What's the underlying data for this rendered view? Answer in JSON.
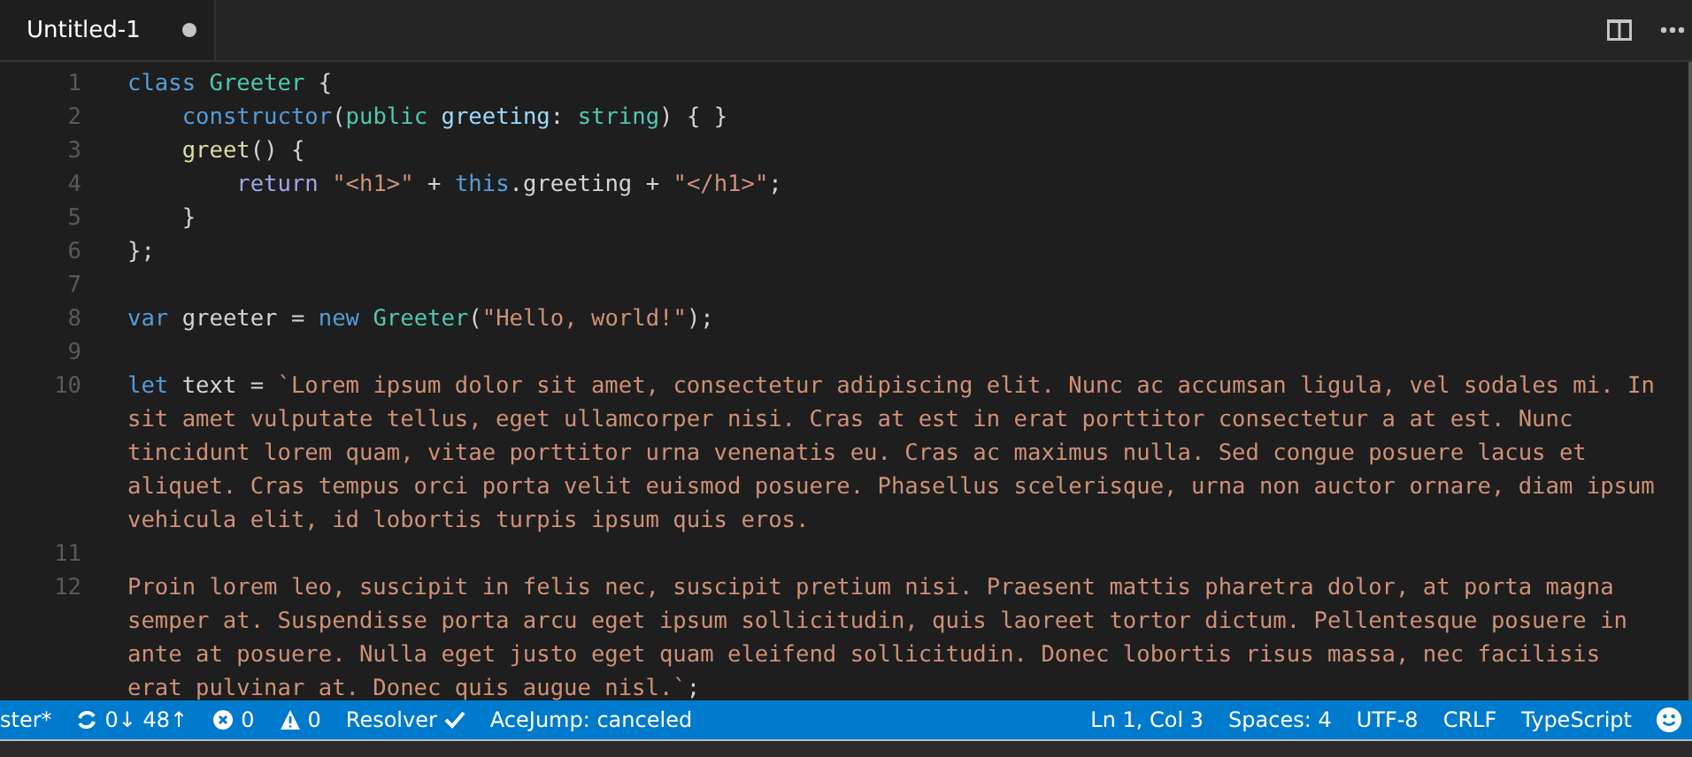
{
  "tab": {
    "title": "Untitled-1",
    "dirty": true
  },
  "lines": [
    {
      "number": "1",
      "rows": [
        [
          {
            "kind": "kw",
            "text": "class"
          },
          {
            "kind": "plain",
            "text": " "
          },
          {
            "kind": "type",
            "text": "Greeter"
          },
          {
            "kind": "plain",
            "text": " {"
          }
        ]
      ]
    },
    {
      "number": "2",
      "rows": [
        [
          {
            "kind": "plain",
            "text": "    "
          },
          {
            "kind": "kw",
            "text": "constructor"
          },
          {
            "kind": "plain",
            "text": "("
          },
          {
            "kind": "type",
            "text": "public"
          },
          {
            "kind": "plain",
            "text": " "
          },
          {
            "kind": "var",
            "text": "greeting"
          },
          {
            "kind": "plain",
            "text": ": "
          },
          {
            "kind": "type",
            "text": "string"
          },
          {
            "kind": "plain",
            "text": ") { }"
          }
        ]
      ]
    },
    {
      "number": "3",
      "rows": [
        [
          {
            "kind": "plain",
            "text": "    "
          },
          {
            "kind": "fn",
            "text": "greet"
          },
          {
            "kind": "plain",
            "text": "() {"
          }
        ]
      ]
    },
    {
      "number": "4",
      "rows": [
        [
          {
            "kind": "plain",
            "text": "        "
          },
          {
            "kind": "ctrl",
            "text": "return"
          },
          {
            "kind": "plain",
            "text": " "
          },
          {
            "kind": "str",
            "text": "\"<h1>\""
          },
          {
            "kind": "plain",
            "text": " + "
          },
          {
            "kind": "kw",
            "text": "this"
          },
          {
            "kind": "plain",
            "text": ".greeting + "
          },
          {
            "kind": "str",
            "text": "\"</h1>\""
          },
          {
            "kind": "plain",
            "text": ";"
          }
        ]
      ]
    },
    {
      "number": "5",
      "rows": [
        [
          {
            "kind": "plain",
            "text": "    }"
          }
        ]
      ]
    },
    {
      "number": "6",
      "rows": [
        [
          {
            "kind": "plain",
            "text": "};"
          }
        ]
      ]
    },
    {
      "number": "7",
      "rows": [
        []
      ]
    },
    {
      "number": "8",
      "rows": [
        [
          {
            "kind": "kw",
            "text": "var"
          },
          {
            "kind": "plain",
            "text": " greeter = "
          },
          {
            "kind": "kw",
            "text": "new"
          },
          {
            "kind": "plain",
            "text": " "
          },
          {
            "kind": "type",
            "text": "Greeter"
          },
          {
            "kind": "plain",
            "text": "("
          },
          {
            "kind": "str",
            "text": "\"Hello, world!\""
          },
          {
            "kind": "plain",
            "text": ");"
          }
        ]
      ]
    },
    {
      "number": "9",
      "rows": [
        []
      ]
    },
    {
      "number": "10",
      "rows": [
        [
          {
            "kind": "kw",
            "text": "let"
          },
          {
            "kind": "plain",
            "text": " text = "
          },
          {
            "kind": "str",
            "text": "`Lorem ipsum dolor sit amet, consectetur adipiscing elit. Nunc ac accumsan ligula, vel sodales mi. In"
          }
        ],
        [
          {
            "kind": "str",
            "text": "sit amet vulputate tellus, eget ullamcorper nisi. Cras at est in erat porttitor consectetur a at est. Nunc"
          }
        ],
        [
          {
            "kind": "str",
            "text": "tincidunt lorem quam, vitae porttitor urna venenatis eu. Cras ac maximus nulla. Sed congue posuere lacus et"
          }
        ],
        [
          {
            "kind": "str",
            "text": "aliquet. Cras tempus orci porta velit euismod posuere. Phasellus scelerisque, urna non auctor ornare, diam ipsum"
          }
        ],
        [
          {
            "kind": "str",
            "text": "vehicula elit, id lobortis turpis ipsum quis eros."
          }
        ]
      ]
    },
    {
      "number": "11",
      "rows": [
        []
      ]
    },
    {
      "number": "12",
      "rows": [
        [
          {
            "kind": "str",
            "text": "Proin lorem leo, suscipit in felis nec, suscipit pretium nisi. Praesent mattis pharetra dolor, at porta magna"
          }
        ],
        [
          {
            "kind": "str",
            "text": "semper at. Suspendisse porta arcu eget ipsum sollicitudin, quis laoreet tortor dictum. Pellentesque posuere in"
          }
        ],
        [
          {
            "kind": "str",
            "text": "ante at posuere. Nulla eget justo eget quam eleifend sollicitudin. Donec lobortis risus massa, nec facilisis"
          }
        ],
        [
          {
            "kind": "str",
            "text": "erat pulvinar at. Donec quis augue nisl.`"
          },
          {
            "kind": "plain",
            "text": ";"
          }
        ]
      ]
    }
  ],
  "status_bar": {
    "left": [
      {
        "kind": "text",
        "text": "ster*"
      },
      {
        "kind": "sync",
        "text": "0↓ 48↑"
      },
      {
        "kind": "error",
        "text": "0"
      },
      {
        "kind": "warning",
        "text": "0"
      },
      {
        "kind": "check",
        "text": "Resolver"
      },
      {
        "kind": "text",
        "text": "AceJump: canceled"
      }
    ],
    "right": [
      "Ln 1, Col 3",
      "Spaces: 4",
      "UTF-8",
      "CRLF",
      "TypeScript"
    ]
  }
}
